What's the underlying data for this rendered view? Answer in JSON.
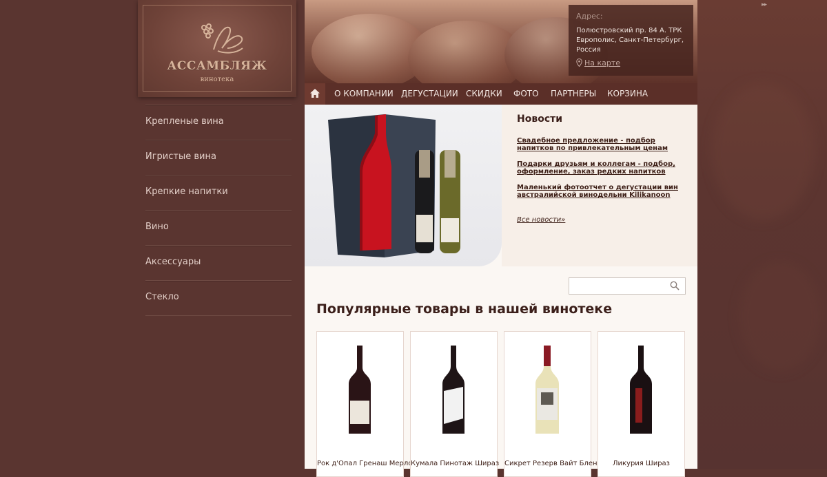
{
  "logo": {
    "title": "АССАМБЛЯЖ",
    "subtitle": "винотека"
  },
  "categories": [
    {
      "label": "Крепленые вина"
    },
    {
      "label": "Игристые вина"
    },
    {
      "label": "Крепкие напитки"
    },
    {
      "label": "Вино"
    },
    {
      "label": "Аксессуары"
    },
    {
      "label": "Стекло"
    }
  ],
  "address": {
    "label": "Адрес:",
    "text": "Полюстровский пр. 84 А. ТРК Европолис, Санкт-Петербург, Россия",
    "map_link": "На карте"
  },
  "nav": {
    "items": [
      {
        "label": "О КОМПАНИИ"
      },
      {
        "label": "ДЕГУСТАЦИИ"
      },
      {
        "label": "СКИДКИ"
      },
      {
        "label": "ФОТО"
      },
      {
        "label": "ПАРТНЕРЫ"
      },
      {
        "label": "КОРЗИНА"
      }
    ]
  },
  "news": {
    "title": "Новости",
    "items": [
      {
        "text": "Свадебное предложение - подбор напитков по привлекательным ценам"
      },
      {
        "text": "Подарки друзьям и коллегам - подбор, оформление, заказ редких напитков"
      },
      {
        "text": "Маленький фотоотчет о дегустации вин австралийской винодельни Kilikanoon"
      }
    ],
    "all_link": "Все новости»"
  },
  "search": {
    "placeholder": ""
  },
  "popular": {
    "title": "Популярные товары в нашей винотеке",
    "products": [
      {
        "name": "Рок д'Опал Гренаш Мерло",
        "bottle_color": "#2a1416",
        "label_color": "#ece6dc"
      },
      {
        "name": "Кумала Пинотаж Шираз",
        "bottle_color": "#1e1416",
        "label_color": "#f2f2f2"
      },
      {
        "name": "Сикрет Резерв Вайт Бленд",
        "bottle_color": "#e9e2b8",
        "label_color": "#eae8e2"
      },
      {
        "name": "Ликурия Шираз",
        "bottle_color": "#1a1012",
        "label_color": "#8a1c1c"
      }
    ]
  },
  "colors": {
    "page_bg": "#5a3530",
    "nav_bg": "#5b2f28",
    "content_bg": "#fbf7f3",
    "text_dark": "#3b1f1a",
    "accent_gold": "#d6b39a"
  }
}
